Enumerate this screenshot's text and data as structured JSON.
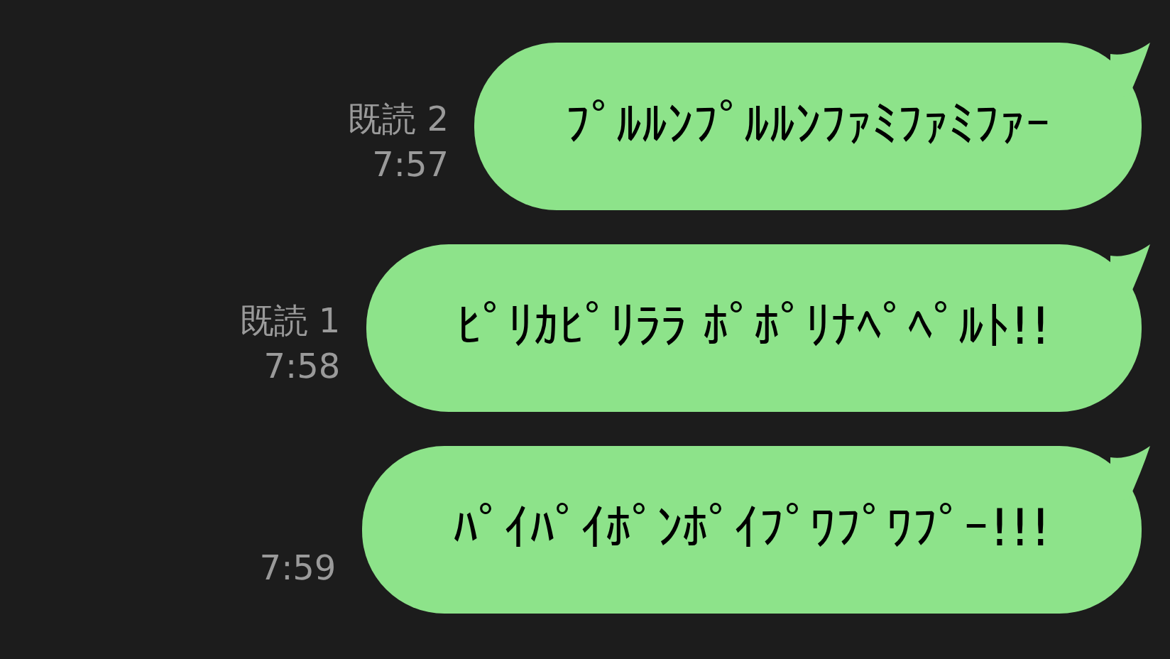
{
  "messages": [
    {
      "read": "既読 2",
      "time": "7:57",
      "text": "ﾌﾟﾙﾙﾝﾌﾟﾙﾙﾝﾌｧﾐﾌｧﾐﾌｧｰ"
    },
    {
      "read": "既読 1",
      "time": "7:58",
      "text": "ﾋﾟﾘｶﾋﾟﾘﾗﾗ ﾎﾟﾎﾟﾘﾅﾍﾟﾍﾟﾙﾄ!!"
    },
    {
      "time": "7:59",
      "text": "ﾊﾟｲﾊﾟｲﾎﾟﾝﾎﾟｲﾌﾟﾜﾌﾟﾜﾌﾟｰ!!!"
    }
  ]
}
